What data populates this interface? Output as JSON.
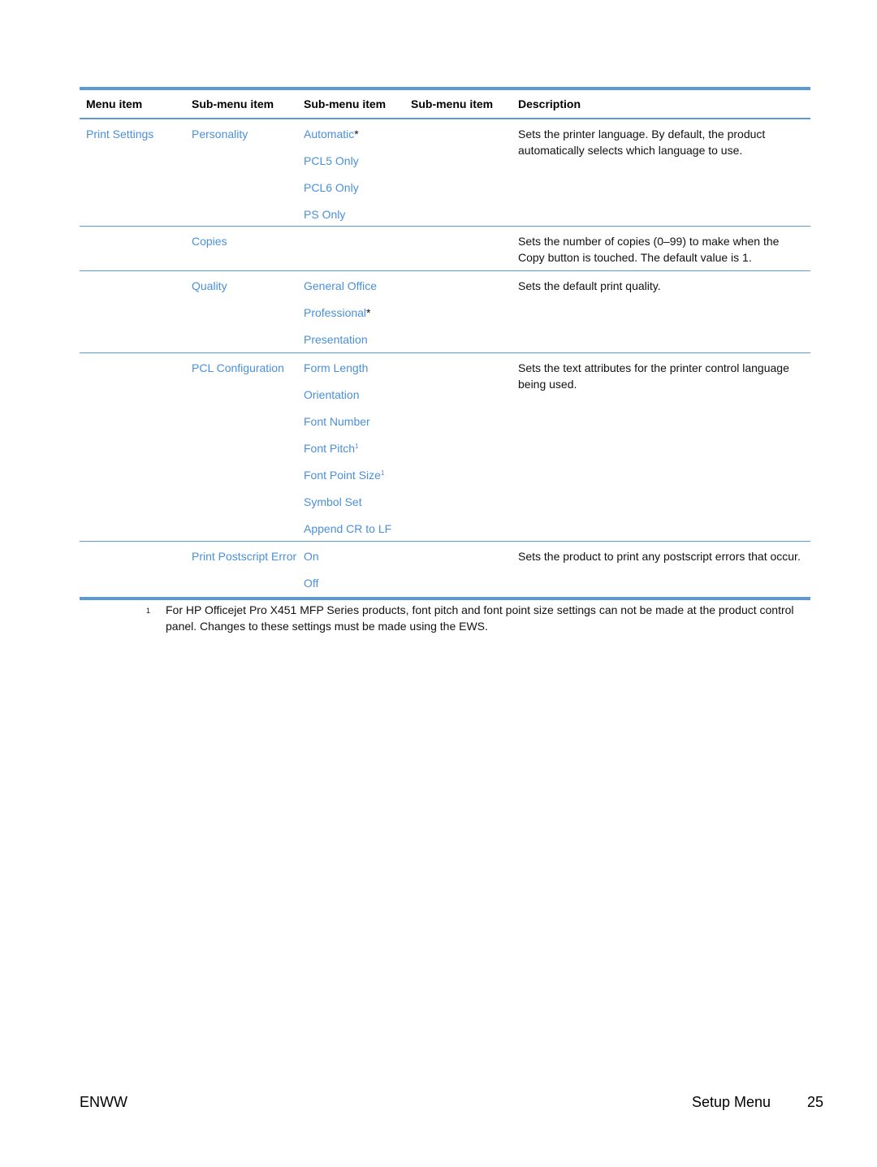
{
  "table": {
    "headers": [
      "Menu item",
      "Sub-menu item",
      "Sub-menu item",
      "Sub-menu item",
      "Description"
    ],
    "rows": [
      {
        "menu": "Print Settings",
        "sub1": [
          "Personality"
        ],
        "sub2": [
          {
            "label": "Automatic",
            "suffix": "*",
            "sup": ""
          },
          {
            "label": "PCL5 Only",
            "suffix": "",
            "sup": ""
          },
          {
            "label": "PCL6 Only",
            "suffix": "",
            "sup": ""
          },
          {
            "label": "PS Only",
            "suffix": "",
            "sup": ""
          }
        ],
        "description": "Sets the printer language. By default, the product automatically selects which language to use."
      },
      {
        "menu": "",
        "sub1": [
          "Copies"
        ],
        "sub2": [],
        "description": "Sets the number of copies (0–99) to make when the Copy button is touched. The default value is 1."
      },
      {
        "menu": "",
        "sub1": [
          "Quality"
        ],
        "sub2": [
          {
            "label": "General Office",
            "suffix": "",
            "sup": ""
          },
          {
            "label": "Professional",
            "suffix": "*",
            "sup": ""
          },
          {
            "label": "Presentation",
            "suffix": "",
            "sup": ""
          }
        ],
        "description": "Sets the default print quality."
      },
      {
        "menu": "",
        "sub1": [
          "PCL Configuration"
        ],
        "sub2": [
          {
            "label": "Form Length",
            "suffix": "",
            "sup": ""
          },
          {
            "label": "Orientation",
            "suffix": "",
            "sup": ""
          },
          {
            "label": "Font Number",
            "suffix": "",
            "sup": ""
          },
          {
            "label": "Font Pitch",
            "suffix": "",
            "sup": "1"
          },
          {
            "label": "Font Point Size",
            "suffix": "",
            "sup": "1"
          },
          {
            "label": "Symbol Set",
            "suffix": "",
            "sup": ""
          },
          {
            "label": "Append CR to LF",
            "suffix": "",
            "sup": ""
          }
        ],
        "description": "Sets the text attributes for the printer control language being used."
      },
      {
        "menu": "",
        "sub1": [
          "Print Postscript Error"
        ],
        "sub2": [
          {
            "label": "On",
            "suffix": "",
            "sup": ""
          },
          {
            "label": "Off",
            "suffix": "",
            "sup": ""
          }
        ],
        "description": "Sets the product to print any postscript errors that occur."
      }
    ]
  },
  "footnote": {
    "mark": "1",
    "text": "For HP Officejet Pro X451 MFP Series products, font pitch and font point size settings can not be made at the product control panel. Changes to these settings must be made using the EWS."
  },
  "footer": {
    "left": "ENWW",
    "section": "Setup Menu",
    "page": "25"
  },
  "colors": {
    "accent": "#5b9bd5",
    "link": "#4a90d9"
  }
}
